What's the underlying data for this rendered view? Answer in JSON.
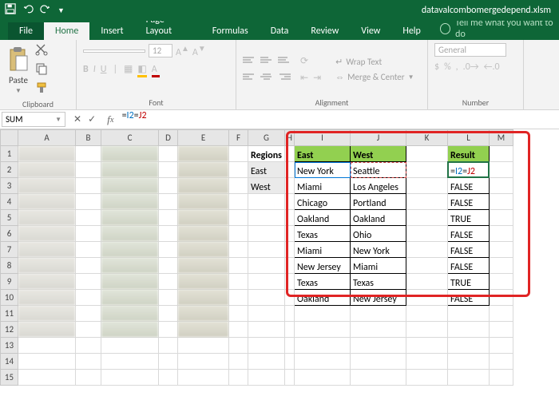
{
  "titlebar": {
    "filename": "datavalcombomergedepend.xlsm"
  },
  "tabs": {
    "file": "File",
    "home": "Home",
    "insert": "Insert",
    "pagelayout": "Page Layout",
    "formulas": "Formulas",
    "data": "Data",
    "review": "Review",
    "view": "View",
    "help": "Help",
    "tellme": "Tell me what you want to do"
  },
  "ribbon": {
    "clipboard": {
      "label": "Clipboard",
      "paste": "Paste"
    },
    "font": {
      "label": "Font",
      "name": "",
      "size": "12",
      "b": "B",
      "i": "I",
      "u": "U"
    },
    "alignment": {
      "label": "Alignment",
      "wrap": "Wrap Text",
      "merge": "Merge & Center"
    },
    "number": {
      "label": "Number",
      "format": "General"
    }
  },
  "fx": {
    "name": "SUM",
    "formula_prefix": "=",
    "formula_i": "I2",
    "formula_eq": "=",
    "formula_j": "J2"
  },
  "columns": [
    "A",
    "B",
    "C",
    "D",
    "E",
    "F",
    "G",
    "H",
    "I",
    "J",
    "K",
    "L",
    "M"
  ],
  "rows": [
    "1",
    "2",
    "3",
    "4",
    "5",
    "6",
    "7",
    "8",
    "9",
    "10",
    "11",
    "12",
    "13",
    "14",
    "15"
  ],
  "sheet": {
    "G1": "Regions",
    "G2": "East",
    "G3": "West",
    "I1": "East",
    "J1": "West",
    "L1": "Result",
    "I2": "New York",
    "J2": "Seattle",
    "L2_pre": "=",
    "L2_i": "I2",
    "L2_e": "=",
    "L2_j": "J2",
    "I3": "Miami",
    "J3": "Los Angeles",
    "L3": "FALSE",
    "I4": "Chicago",
    "J4": "Portland",
    "L4": "FALSE",
    "I5": "Oakland",
    "J5": "Oakland",
    "L5": "TRUE",
    "I6": "Texas",
    "J6": "Ohio",
    "L6": "FALSE",
    "I7": "Miami",
    "J7": "New York",
    "L7": "FALSE",
    "I8": "New Jersey",
    "J8": "Miami",
    "L8": "FALSE",
    "I9": "Texas",
    "J9": "Texas",
    "L9": "TRUE",
    "I10": "Oakland",
    "J10": "New Jersey",
    "L10": "FALSE"
  }
}
